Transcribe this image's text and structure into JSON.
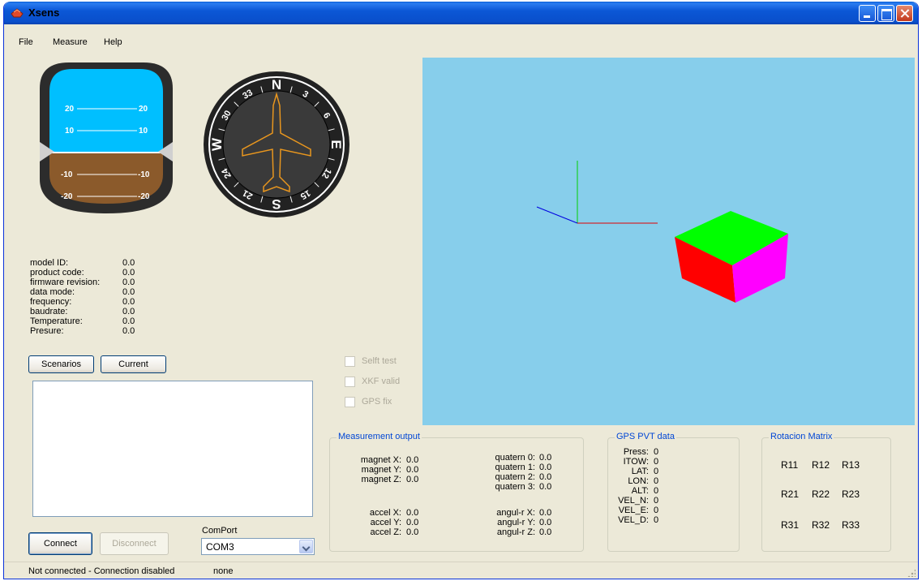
{
  "window": {
    "title": "Xsens",
    "colors": {
      "face": "#ece9d8",
      "titlebar": "#0b57d6",
      "view_bg": "#87ceeb",
      "sky": "#00bfff",
      "ground": "#8b5a2b"
    }
  },
  "menu": {
    "items": [
      "File",
      "Measure",
      "Help"
    ]
  },
  "horizon": {
    "pitch_labels": [
      "20",
      "20",
      "10",
      "10",
      "-10",
      "-10",
      "-20",
      "-20"
    ]
  },
  "compass": {
    "heading_labels": [
      "N",
      "3",
      "6",
      "E",
      "12",
      "15",
      "S",
      "21",
      "24",
      "W",
      "30",
      "33"
    ]
  },
  "device_info": [
    {
      "label": "model ID:",
      "value": "0.0"
    },
    {
      "label": "product code:",
      "value": "0.0"
    },
    {
      "label": "firmware revision:",
      "value": "0.0"
    },
    {
      "label": "data mode:",
      "value": "0.0"
    },
    {
      "label": "frequency:",
      "value": "0.0"
    },
    {
      "label": "baudrate:",
      "value": "0.0"
    },
    {
      "label": "Temperature:",
      "value": "0.0"
    },
    {
      "label": "Presure:",
      "value": "0.0"
    }
  ],
  "buttons": {
    "scenarios": "Scenarios",
    "current": "Current",
    "connect": "Connect",
    "disconnect": "Disconnect"
  },
  "comport": {
    "label": "ComPort",
    "value": "COM3"
  },
  "checks": [
    {
      "label": "Selft test",
      "checked": false
    },
    {
      "label": "XKF valid",
      "checked": false
    },
    {
      "label": "GPS fix",
      "checked": false
    }
  ],
  "measurement": {
    "title": "Measurement output",
    "magnet": [
      {
        "label": "magnet X:",
        "value": "0.0"
      },
      {
        "label": "magnet Y:",
        "value": "0.0"
      },
      {
        "label": "magnet Z:",
        "value": "0.0"
      }
    ],
    "accel": [
      {
        "label": "accel X:",
        "value": "0.0"
      },
      {
        "label": "accel Y:",
        "value": "0.0"
      },
      {
        "label": "accel Z:",
        "value": "0.0"
      }
    ],
    "quatern": [
      {
        "label": "quatern 0:",
        "value": "0.0"
      },
      {
        "label": "quatern 1:",
        "value": "0.0"
      },
      {
        "label": "quatern 2:",
        "value": "0.0"
      },
      {
        "label": "quatern 3:",
        "value": "0.0"
      }
    ],
    "angulr": [
      {
        "label": "angul-r X:",
        "value": "0.0"
      },
      {
        "label": "angul-r Y:",
        "value": "0.0"
      },
      {
        "label": "angul-r Z:",
        "value": "0.0"
      }
    ]
  },
  "gps": {
    "title": "GPS PVT data",
    "rows": [
      {
        "label": "Press:",
        "value": "0"
      },
      {
        "label": "ITOW:",
        "value": "0"
      },
      {
        "label": "LAT:",
        "value": "0"
      },
      {
        "label": "LON:",
        "value": "0"
      },
      {
        "label": "ALT:",
        "value": "0"
      },
      {
        "label": "VEL_N:",
        "value": "0"
      },
      {
        "label": "VEL_E:",
        "value": "0"
      },
      {
        "label": "VEL_D:",
        "value": "0"
      }
    ]
  },
  "rotation": {
    "title": "Rotacion Matrix",
    "cells": [
      [
        "R11",
        "R12",
        "R13"
      ],
      [
        "R21",
        "R22",
        "R23"
      ],
      [
        "R31",
        "R32",
        "R33"
      ]
    ]
  },
  "status": {
    "connection": "Not connected - Connection disabled",
    "mode": "none"
  }
}
